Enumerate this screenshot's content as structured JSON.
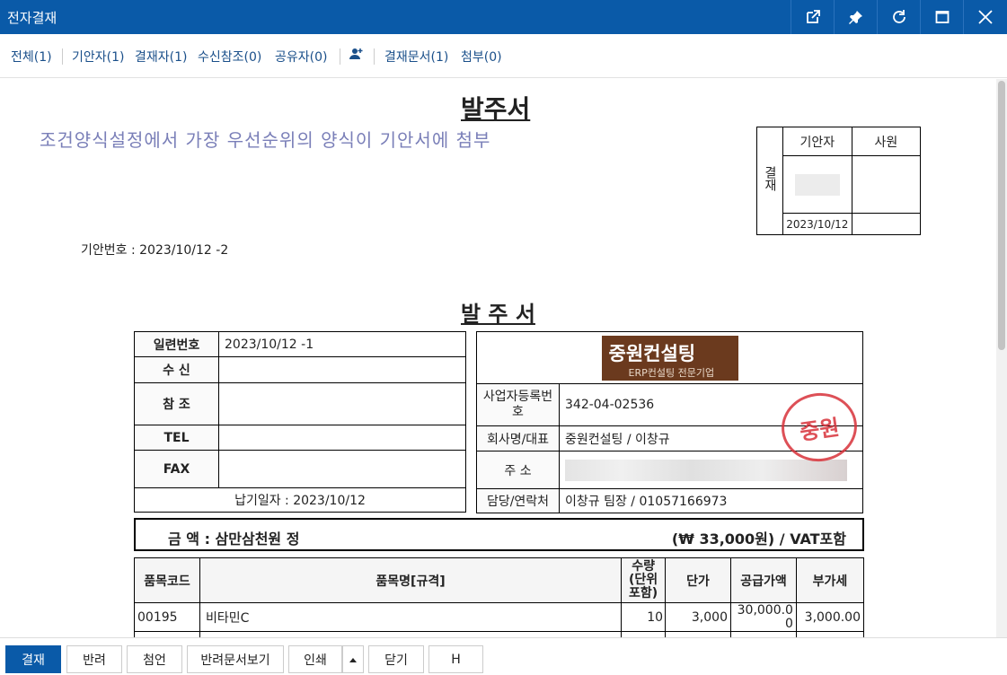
{
  "window": {
    "title": "전자결재"
  },
  "subnav": {
    "all": "전체(1)",
    "drafter": "기안자(1)",
    "approver": "결재자(1)",
    "receiver_ref": "수신참조(0)",
    "sharer": "공유자(0)",
    "approval_doc": "결재문서(1)",
    "attachment": "첨부(0)"
  },
  "doc": {
    "main_title": "발주서",
    "condition_text": "조건양식설정에서 가장 우선순위의 양식이 기안서에 첨부",
    "draft_no": "기안번호 : 2023/10/12 -2",
    "approval_box": {
      "side_label": "결재",
      "col1": "기안자",
      "col2": "사원",
      "date": "2023/10/12"
    },
    "po_title": "발 주 서",
    "left": {
      "serial_label": "일련번호",
      "serial_value": "2023/10/12 -1",
      "recv_label": "수 신",
      "recv_value": "",
      "ref_label": "참 조",
      "ref_value": "",
      "tel_label": "TEL",
      "tel_value": "",
      "fax_label": "FAX",
      "fax_value": "",
      "delivery": "납기일자 : 2023/10/12"
    },
    "right": {
      "logo_title": "중원컨설팅",
      "logo_sub": "ERP컨설팅 전문기업",
      "bizno_label": "사업자등록번호",
      "bizno_value": "342-04-02536",
      "company_label": "회사명/대표",
      "company_value": "중원컨설팅 / 이창규",
      "addr_label": "주 소",
      "contact_label": "담당/연락처",
      "contact_value": "이창규 팀장 / 01057166973",
      "stamp_text": "중원"
    },
    "amount": {
      "left": "금 액 : 삼만삼천원 정",
      "right": "(₩ 33,000원) / VAT포함"
    },
    "items_table": {
      "headers": [
        "품목코드",
        "품목명[규격]",
        "수량\n(단위\n포함)",
        "단가",
        "공급가액",
        "부가세"
      ],
      "rows": [
        [
          "00195",
          "비타민C",
          "10",
          "3,000",
          "30,000.0\n0",
          "3,000.00"
        ]
      ]
    }
  },
  "buttons": {
    "approve": "결재",
    "reject": "반려",
    "comment": "첨언",
    "view_rejected": "반려문서보기",
    "print": "인쇄",
    "close": "닫기",
    "h": "H"
  },
  "colors": {
    "titlebar": "#0a5aa8",
    "stamp": "#d8323a",
    "logo_bg": "#6b3a1e",
    "subtitle": "#7a7fb8"
  }
}
